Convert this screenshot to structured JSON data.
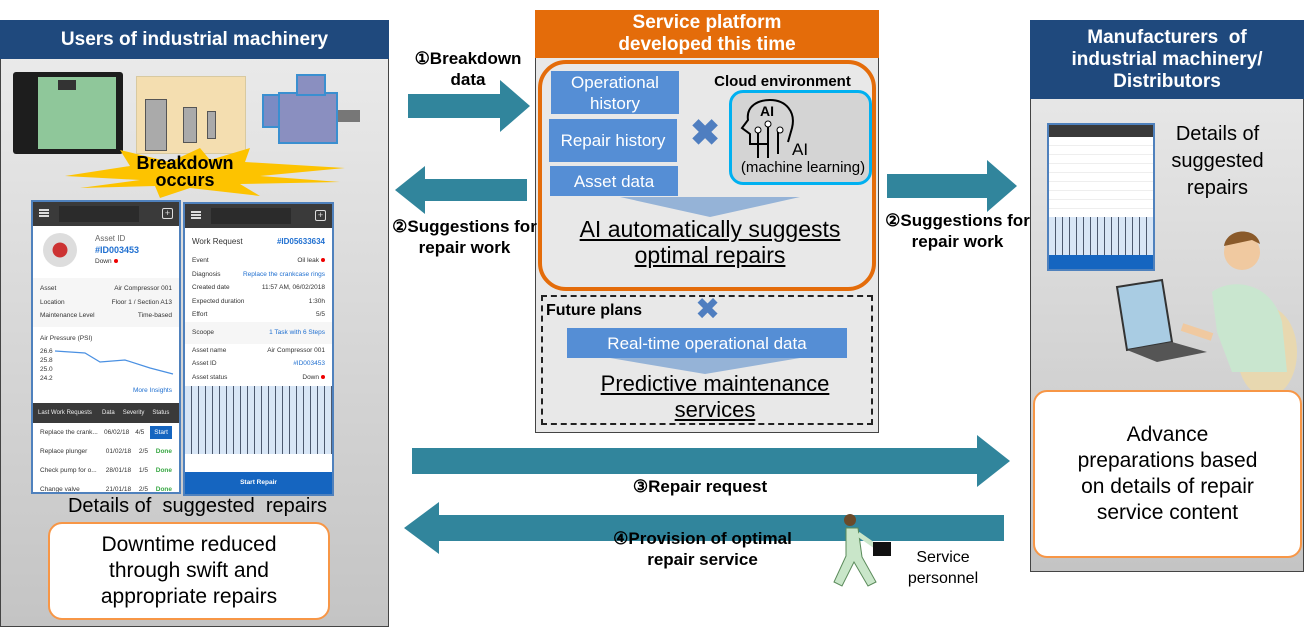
{
  "left": {
    "title": "Users of industrial machinery",
    "breakdown": "Breakdown occurs",
    "caption": "Details of  suggested  repairs",
    "benefit": "Downtime reduced through swift and appropriate repairs",
    "phone1": {
      "asset_id_label": "Asset ID",
      "asset_id": "#ID003453",
      "status": "Down",
      "fields": [
        {
          "k": "Asset",
          "v": "Air Compressor 001"
        },
        {
          "k": "Location",
          "v": "Floor 1 / Section A13"
        },
        {
          "k": "Maintenance Level",
          "v": "Time-based"
        }
      ],
      "chart_title": "Air Pressure (PSI)",
      "chart_ticks": [
        "26.6",
        "25.8",
        "25.0",
        "24.2"
      ],
      "more": "More Insights",
      "table_headers": [
        "Last Work Requests",
        "Data",
        "Severity",
        "Status"
      ],
      "rows": [
        {
          "name": "Replace the crank...",
          "date": "06/02/18",
          "sev": "4/5",
          "status": "Start"
        },
        {
          "name": "Replace plunger",
          "date": "01/02/18",
          "sev": "2/5",
          "status": "Done"
        },
        {
          "name": "Check pump for o...",
          "date": "28/01/18",
          "sev": "1/5",
          "status": "Done"
        },
        {
          "name": "Change valve",
          "date": "21/01/18",
          "sev": "2/5",
          "status": "Done"
        }
      ]
    },
    "phone2": {
      "title": "Work Request",
      "id": "#ID05633634",
      "fields": [
        {
          "k": "Event",
          "v": "Oil leak"
        },
        {
          "k": "Diagnosis",
          "v": "Replace the crankcase rings"
        },
        {
          "k": "Created date",
          "v": "11:57 AM, 06/02/2018"
        },
        {
          "k": "Expected duration",
          "v": "1:30h"
        },
        {
          "k": "Effort",
          "v": "5/5"
        }
      ],
      "scope_k": "Scoope",
      "scope_v": "1 Task with 6 Steps",
      "asset": [
        {
          "k": "Asset name",
          "v": "Air Compressor 001"
        },
        {
          "k": "Asset ID",
          "v": "#ID003453"
        },
        {
          "k": "Asset status",
          "v": "Down"
        }
      ],
      "button": "Start Repair"
    }
  },
  "center": {
    "title": "Service platform developed this time",
    "data": [
      "Operational history",
      "Repair history",
      "Asset data"
    ],
    "cloud": "Cloud environment",
    "ai_logo": "AI",
    "ai": "AI",
    "ml": "(machine learning)",
    "result": "AI automatically suggests optimal repairs",
    "future": "Future plans",
    "realtime": "Real-time operational data",
    "predictive": "Predictive maintenance services"
  },
  "right": {
    "title": "Manufacturers  of industrial machinery/ Distributors",
    "details": "Details of suggested repairs",
    "benefit": "Advance preparations based on details of repair service content"
  },
  "arrows": {
    "a1": "①Breakdown data",
    "a2l": "②Suggestions for repair work",
    "a2r": "②Suggestions for repair work",
    "a3": "③Repair request",
    "a4": "④Provision of optimal repair service",
    "personnel": "Service personnel"
  },
  "colors": {
    "navy": "#1f497d",
    "orange": "#e46c0a",
    "teal": "#31859c",
    "data_blue": "#558ed5",
    "cloud_border": "#00b0f0"
  }
}
